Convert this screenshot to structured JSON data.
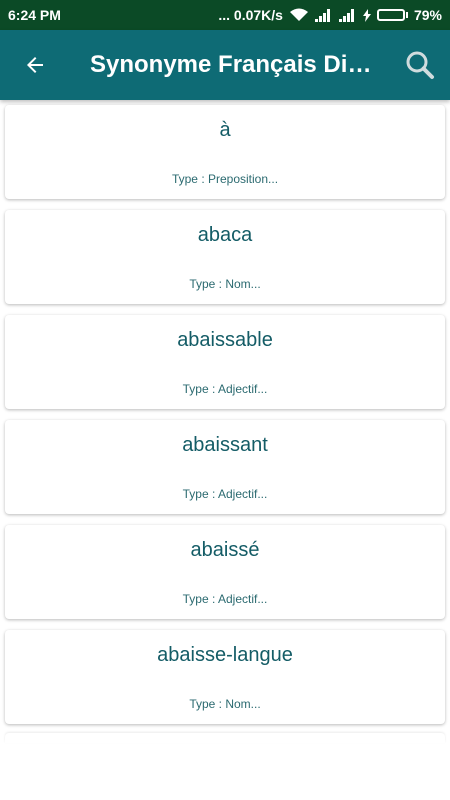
{
  "status_bar": {
    "time": "6:24 PM",
    "network_speed": "... 0.07K/s",
    "battery_percent": "79%",
    "battery_level": 0.79
  },
  "app_bar": {
    "title": "Synonyme Français Dict…",
    "back_icon": "arrow-left-icon",
    "search_icon": "search-icon"
  },
  "entries": [
    {
      "word": "à",
      "type": "Type : Preposition..."
    },
    {
      "word": "abaca",
      "type": "Type : Nom..."
    },
    {
      "word": "abaissable",
      "type": "Type : Adjectif..."
    },
    {
      "word": "abaissant",
      "type": "Type : Adjectif..."
    },
    {
      "word": "abaissé",
      "type": "Type : Adjectif..."
    },
    {
      "word": "abaisse-langue",
      "type": "Type : Nom..."
    }
  ]
}
